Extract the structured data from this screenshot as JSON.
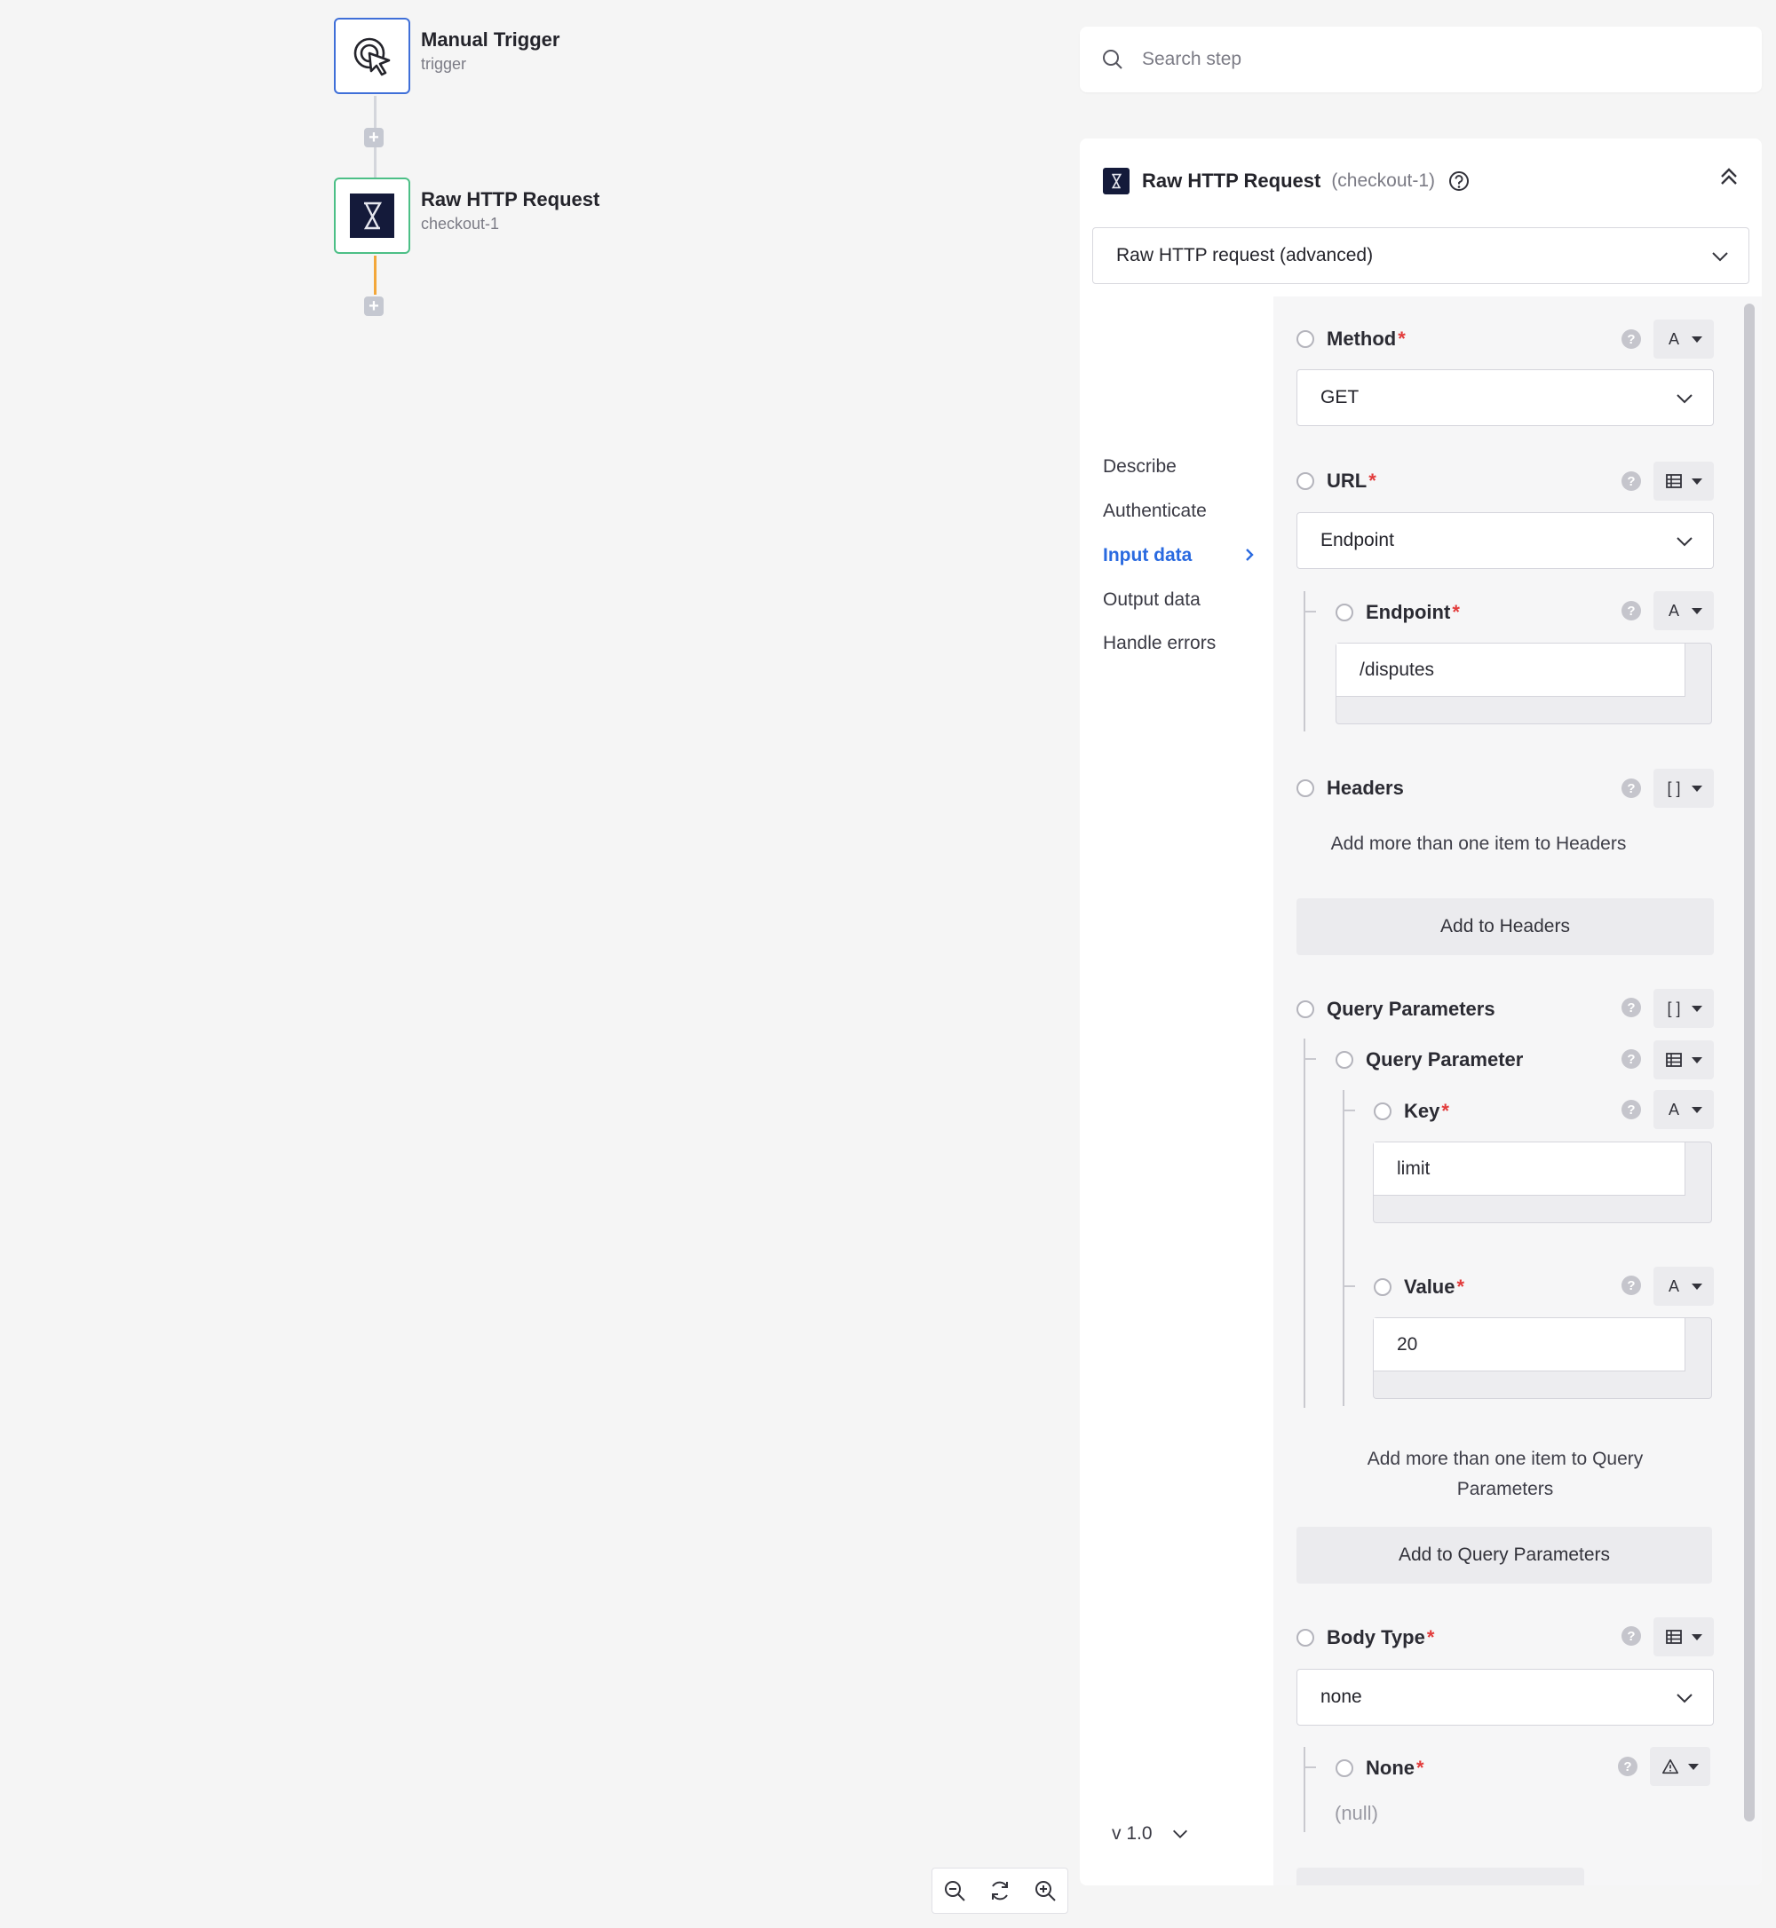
{
  "canvas": {
    "nodes": [
      {
        "title": "Manual Trigger",
        "subtitle": "trigger",
        "icon": "cursor-click-icon"
      },
      {
        "title": "Raw HTTP Request",
        "subtitle": "checkout-1",
        "icon": "checkout-logo-icon"
      }
    ],
    "accent": "#3f6fd8",
    "success": "#4cbf86",
    "active_edge": "#f3a73a"
  },
  "search": {
    "placeholder": "Search step"
  },
  "panel": {
    "title": "Raw HTTP Request",
    "id": "(checkout-1)",
    "action": "Raw HTTP request (advanced)",
    "nav": [
      "Describe",
      "Authenticate",
      "Input data",
      "Output data",
      "Handle errors"
    ],
    "active_nav": "Input data",
    "version": "v 1.0"
  },
  "form": {
    "method": {
      "label": "Method",
      "required": "*",
      "value": "GET",
      "type": "A"
    },
    "url": {
      "label": "URL",
      "required": "*",
      "value": "Endpoint"
    },
    "endpoint": {
      "label": "Endpoint",
      "required": "*",
      "value": "/disputes",
      "type": "A"
    },
    "headers": {
      "label": "Headers",
      "type": "[ ]",
      "info": "Add more than one item to Headers",
      "add": "Add to Headers"
    },
    "query_parameters": {
      "label": "Query Parameters",
      "type": "[ ]",
      "item_label": "Query Parameter",
      "key": {
        "label": "Key",
        "required": "*",
        "value": "limit",
        "type": "A"
      },
      "value": {
        "label": "Value",
        "required": "*",
        "value": "20",
        "type": "A"
      },
      "info": "Add more than one item to Query Parameters",
      "add": "Add to Query Parameters"
    },
    "body_type": {
      "label": "Body Type",
      "required": "*",
      "value": "none"
    },
    "none": {
      "label": "None",
      "required": "*",
      "value": "(null)"
    }
  }
}
